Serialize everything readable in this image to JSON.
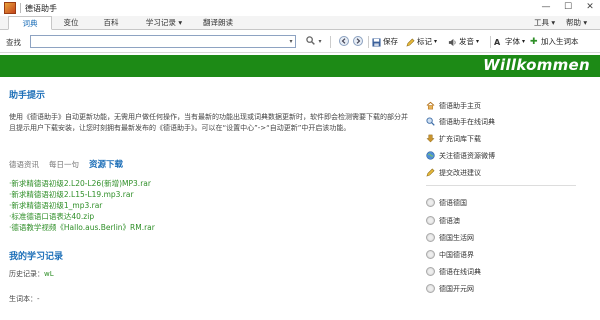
{
  "app": {
    "title": "德语助手"
  },
  "window_controls": {
    "minimize": "—",
    "maximize": "☐",
    "close": "✕"
  },
  "menubar": {
    "tabs": [
      "词典",
      "变位",
      "百科",
      "学习记录",
      "翻译朗读"
    ],
    "active_tab": "词典",
    "right": [
      "工具",
      "帮助"
    ]
  },
  "toolbar": {
    "search_label": "查找",
    "search_value": "",
    "buttons": {
      "save": "保存",
      "mark": "标记",
      "pronounce": "发音",
      "font": "字体",
      "add_vocab": "加入生词本"
    }
  },
  "banner": {
    "text": "Willkommen",
    "color": "#1d8a16"
  },
  "helper": {
    "title": "助手提示",
    "text": "使用《德语助手》自动更新功能，无需用户做任何操作，当有最新的功能出现或词典数据更新时，软件即会检测需要下载的部分并且提示用户下载安装，让您时刻拥有最新发布的《德语助手》。可以在“设置中心”->“自动更新”中开启该功能。"
  },
  "subtabs": [
    "德语资讯",
    "每日一句",
    "资源下载"
  ],
  "downloads": [
    "·新求精德语初级2.L20-L26(新增)MP3.rar",
    "·新求精德语初级2.L15-L19.mp3.rar",
    "·新求精德语初级1_mp3.rar",
    "·标准德语口语表达40.zip",
    "·德语教学视频《Hallo.aus.Berlin》RM.rar"
  ],
  "study": {
    "title": "我的学习记录",
    "history_label": "历史记录：",
    "history_value": "wL",
    "vocab_label": "生词本：",
    "vocab_value": "-"
  },
  "side_links": [
    {
      "label": "德语助手主页",
      "icon": "home-icon"
    },
    {
      "label": "德语助手在线词典",
      "icon": "search-icon"
    },
    {
      "label": "扩充词库下载",
      "icon": "download-icon"
    },
    {
      "label": "关注德语资源微博",
      "icon": "globe-icon"
    },
    {
      "label": "提交改进建议",
      "icon": "pencil-icon"
    }
  ],
  "side_sites": [
    "德语德国",
    "德语澳",
    "德国生活网",
    "中国德语界",
    "德语在线词典",
    "德国开元网"
  ],
  "colors": {
    "accent": "#1d6fb8",
    "link_green": "#2f8f28",
    "banner": "#1d8a16"
  }
}
